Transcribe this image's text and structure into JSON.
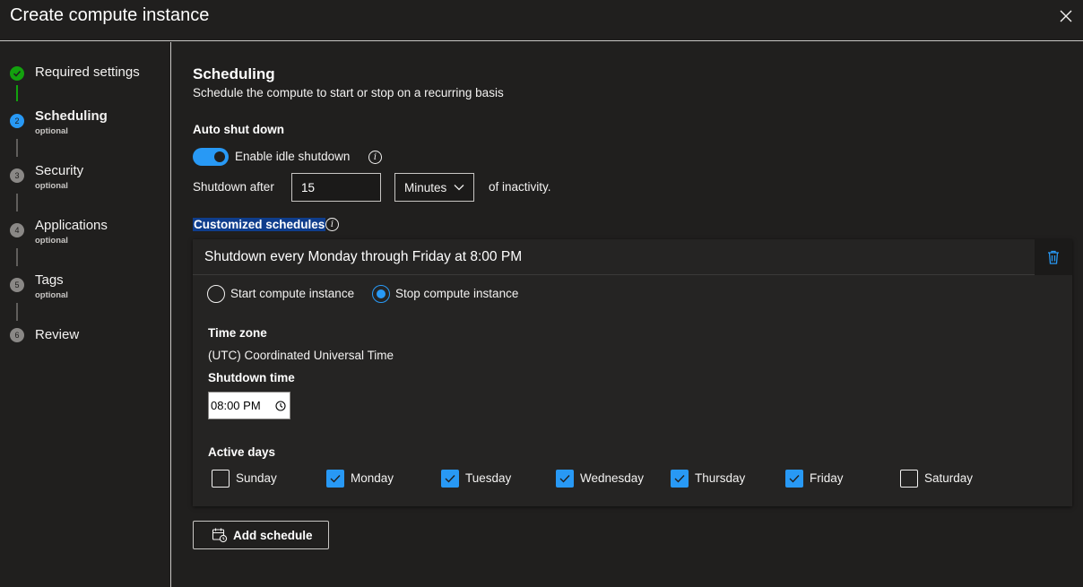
{
  "window": {
    "title": "Create compute instance"
  },
  "steps": [
    {
      "number": "",
      "label": "Required settings",
      "sub": "",
      "status": "complete"
    },
    {
      "number": "2",
      "label": "Scheduling",
      "sub": "optional",
      "status": "current"
    },
    {
      "number": "3",
      "label": "Security",
      "sub": "optional",
      "status": "pending"
    },
    {
      "number": "4",
      "label": "Applications",
      "sub": "optional",
      "status": "pending"
    },
    {
      "number": "5",
      "label": "Tags",
      "sub": "optional",
      "status": "pending"
    },
    {
      "number": "6",
      "label": "Review",
      "sub": "",
      "status": "pending"
    }
  ],
  "section": {
    "title": "Scheduling",
    "description": "Schedule the compute to start or stop on a recurring basis"
  },
  "auto_shutdown": {
    "heading": "Auto shut down",
    "toggle_label": "Enable idle shutdown",
    "toggle_on": true,
    "shutdown_after_label": "Shutdown after",
    "value": "15",
    "unit": "Minutes",
    "suffix": "of inactivity."
  },
  "customized": {
    "heading": "Customized schedules"
  },
  "schedule": {
    "title": "Shutdown every Monday through Friday at 8:00 PM",
    "action_start": "Start compute instance",
    "action_stop": "Stop compute instance",
    "selected_action": "stop",
    "timezone_label": "Time zone",
    "timezone_value": "(UTC) Coordinated Universal Time",
    "time_label": "Shutdown time",
    "time_value": "08:00 PM",
    "active_days_label": "Active days",
    "days": [
      {
        "label": "Sunday",
        "checked": false
      },
      {
        "label": "Monday",
        "checked": true
      },
      {
        "label": "Tuesday",
        "checked": true
      },
      {
        "label": "Wednesday",
        "checked": true
      },
      {
        "label": "Thursday",
        "checked": true
      },
      {
        "label": "Friday",
        "checked": true
      },
      {
        "label": "Saturday",
        "checked": false
      }
    ]
  },
  "add_schedule": {
    "label": "Add schedule"
  },
  "colors": {
    "accent": "#2899f5",
    "complete": "#13a10e",
    "pending": "#8a8886",
    "background": "#201f1e",
    "highlight": "#0f3d8c"
  },
  "icons": {
    "close": "close-icon",
    "complete": "checkmark-circle-icon",
    "info": "info-icon",
    "chevron": "chevron-down-icon",
    "delete": "trash-icon",
    "clock": "clock-icon",
    "calendar": "calendar-add-icon"
  }
}
